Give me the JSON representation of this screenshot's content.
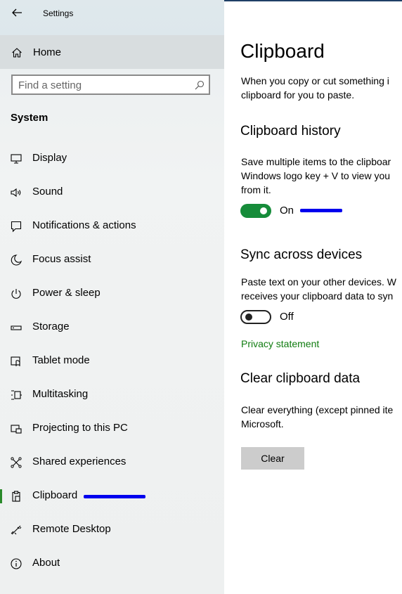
{
  "window": {
    "title": "Settings"
  },
  "sidebar": {
    "home_label": "Home",
    "search": {
      "placeholder": "Find a setting"
    },
    "section_title": "System",
    "items": [
      {
        "label": "Display",
        "icon": "display-icon"
      },
      {
        "label": "Sound",
        "icon": "speaker-icon"
      },
      {
        "label": "Notifications & actions",
        "icon": "notification-icon"
      },
      {
        "label": "Focus assist",
        "icon": "moon-icon"
      },
      {
        "label": "Power & sleep",
        "icon": "power-icon"
      },
      {
        "label": "Storage",
        "icon": "storage-icon"
      },
      {
        "label": "Tablet mode",
        "icon": "tablet-icon"
      },
      {
        "label": "Multitasking",
        "icon": "multitasking-icon"
      },
      {
        "label": "Projecting to this PC",
        "icon": "project-icon"
      },
      {
        "label": "Shared experiences",
        "icon": "shared-icon"
      },
      {
        "label": "Clipboard",
        "icon": "clipboard-icon",
        "active": true
      },
      {
        "label": "Remote Desktop",
        "icon": "remote-desktop-icon"
      },
      {
        "label": "About",
        "icon": "info-icon"
      }
    ]
  },
  "content": {
    "title": "Clipboard",
    "intro_lines": [
      "When you copy or cut something i",
      "clipboard for you to paste."
    ],
    "history": {
      "heading": "Clipboard history",
      "desc_lines": [
        "Save multiple items to the clipboar",
        "Windows logo key + V to view you",
        "from it."
      ],
      "toggle_state": "On"
    },
    "sync": {
      "heading": "Sync across devices",
      "desc_lines": [
        "Paste text on your other devices. W",
        "receives your clipboard data to syn"
      ],
      "toggle_state": "Off",
      "privacy_link": "Privacy statement"
    },
    "clear": {
      "heading": "Clear clipboard data",
      "desc_lines": [
        "Clear everything (except pinned ite",
        "Microsoft."
      ],
      "button_label": "Clear"
    }
  },
  "colors": {
    "accent_green": "#168c3a",
    "link_green": "#107c10",
    "annotation_blue": "#0000ee"
  }
}
